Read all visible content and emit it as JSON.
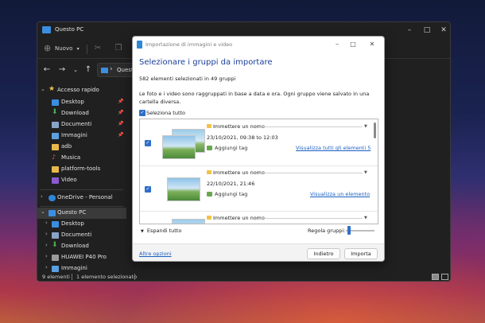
{
  "explorer": {
    "title": "Questo PC",
    "toolbar": {
      "new_label": "Nuovo"
    },
    "address": {
      "path": "Questo PC"
    },
    "sidebar": {
      "quick_access": "Accesso rapido",
      "quick_items": [
        "Desktop",
        "Download",
        "Documenti",
        "Immagini",
        "adb",
        "Musica",
        "platform-tools",
        "Video"
      ],
      "onedrive": "OneDrive - Personal",
      "this_pc": "Questo PC",
      "pc_items": [
        "Desktop",
        "Documenti",
        "Download",
        "HUAWEI P40 Pro",
        "Immagini"
      ]
    },
    "status": {
      "items": "9 elementi",
      "selected": "1 elemento selezionato"
    }
  },
  "dialog": {
    "title": "Importazione di immagini e video",
    "heading": "Selezionare i gruppi da importare",
    "count": "582 elementi selezionati in 49 gruppi",
    "description": "Le foto e i video sono raggruppati in base a data e ora. Ogni gruppo viene salvato in una cartella diversa.",
    "select_all": "Seleziona tutto",
    "groups": [
      {
        "name": "Immettere un nome",
        "date": "23/10/2021, 09:38 to 12:03",
        "tag": "Aggiungi tag",
        "link": "Visualizza tutti gli elementi 5"
      },
      {
        "name": "Immettere un nome",
        "date": "22/10/2021, 21:46",
        "tag": "Aggiungi tag",
        "link": "Visualizza un elemento"
      },
      {
        "name": "Immettere un nome"
      }
    ],
    "expand_all": "Espandi tutto",
    "adjust_groups": "Regola gruppi:",
    "more_options": "Altre opzioni",
    "back": "Indietro",
    "import": "Importa"
  },
  "colors": {
    "accent": "#2f6fc9",
    "heading": "#1a3e9a",
    "link": "#1a5fc2",
    "explorer_bg": "#202020"
  }
}
